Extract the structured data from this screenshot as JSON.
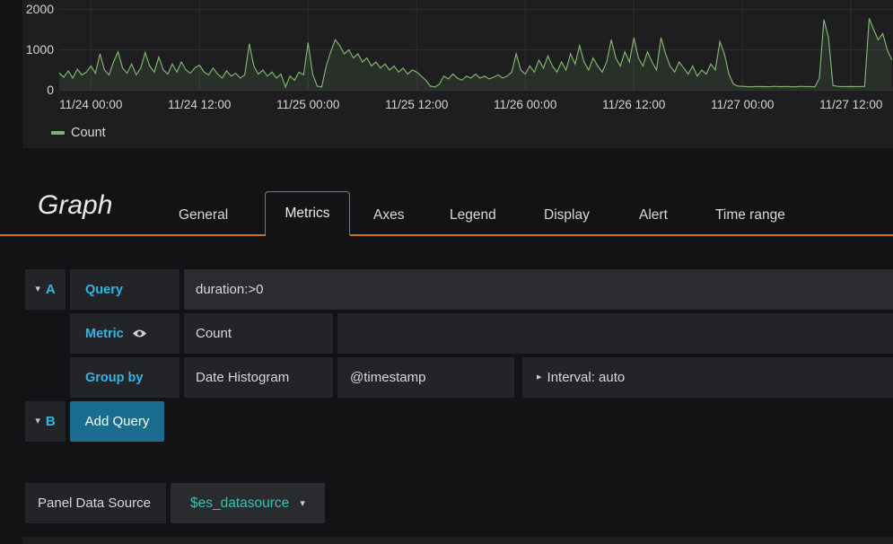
{
  "chart_data": {
    "type": "area",
    "title": "",
    "xlabel": "",
    "ylabel": "",
    "ylim": [
      0,
      2200
    ],
    "y_ticks": [
      0,
      1000,
      2000
    ],
    "grid": true,
    "legend_position": "bottom-left",
    "x_start": "11/23 20:30",
    "x_step_minutes": 30,
    "x_ticks": [
      {
        "label": "11/24 00:00",
        "index": 7
      },
      {
        "label": "11/24 12:00",
        "index": 31
      },
      {
        "label": "11/25 00:00",
        "index": 55
      },
      {
        "label": "11/25 12:00",
        "index": 79
      },
      {
        "label": "11/26 00:00",
        "index": 103
      },
      {
        "label": "11/26 12:00",
        "index": 127
      },
      {
        "label": "11/27 00:00",
        "index": 151
      },
      {
        "label": "11/27 12:00",
        "index": 175
      }
    ],
    "series": [
      {
        "name": "Count",
        "color": "#7eb26d",
        "fill_opacity": 0.12,
        "values": [
          430,
          320,
          480,
          300,
          520,
          380,
          450,
          600,
          420,
          900,
          500,
          380,
          700,
          950,
          550,
          420,
          650,
          380,
          550,
          930,
          600,
          450,
          820,
          500,
          400,
          650,
          450,
          700,
          500,
          420,
          560,
          620,
          450,
          380,
          550,
          400,
          300,
          480,
          350,
          420,
          300,
          380,
          1150,
          600,
          400,
          500,
          350,
          450,
          300,
          400,
          80,
          350,
          250,
          450,
          380,
          1180,
          400,
          100,
          80,
          600,
          950,
          1250,
          1100,
          900,
          1000,
          800,
          900,
          700,
          800,
          600,
          700,
          550,
          650,
          500,
          600,
          450,
          550,
          400,
          500,
          450,
          350,
          250,
          100,
          80,
          150,
          350,
          280,
          400,
          300,
          250,
          350,
          300,
          400,
          300,
          350,
          280,
          320,
          380,
          300,
          350,
          450,
          900,
          500,
          400,
          600,
          450,
          750,
          550,
          850,
          600,
          450,
          700,
          500,
          900,
          650,
          1100,
          700,
          500,
          800,
          600,
          450,
          700,
          1250,
          800,
          600,
          950,
          700,
          1300,
          800,
          600,
          950,
          700,
          500,
          1300,
          900,
          600,
          450,
          700,
          550,
          400,
          600,
          350,
          500,
          400,
          650,
          500,
          1200,
          900,
          400,
          150,
          100,
          95,
          90,
          85,
          92,
          88,
          90,
          85,
          95,
          90,
          88,
          92,
          85,
          90,
          95,
          88,
          90,
          85,
          300,
          1750,
          1300,
          120,
          95,
          90,
          88,
          92,
          88,
          90,
          95,
          1780,
          1500,
          1250,
          1400,
          1000,
          750
        ]
      }
    ]
  },
  "editor": {
    "title": "Graph",
    "tabs": [
      {
        "label": "General",
        "active": false
      },
      {
        "label": "Metrics",
        "active": true
      },
      {
        "label": "Axes",
        "active": false
      },
      {
        "label": "Legend",
        "active": false
      },
      {
        "label": "Display",
        "active": false
      },
      {
        "label": "Alert",
        "active": false
      },
      {
        "label": "Time range",
        "active": false
      }
    ],
    "rows": {
      "a": {
        "collapse_icon": "▾",
        "letter": "A",
        "query_label": "Query",
        "query_value": "duration:>0",
        "metric_label": "Metric",
        "metric_value": "Count",
        "groupby_label": "Group by",
        "groupby_type": "Date Histogram",
        "groupby_field": "@timestamp",
        "interval_caret": "▸",
        "interval_value": "Interval: auto"
      },
      "b": {
        "collapse_icon": "▾",
        "letter": "B",
        "add_query_label": "Add Query"
      }
    },
    "datasource": {
      "label": "Panel Data Source",
      "value": "$es_datasource",
      "caret": "▾"
    }
  },
  "colors": {
    "accent_blue": "#33b5e5",
    "series_green": "#7eb26d",
    "tab_orange": "#cf7216",
    "button_teal": "#1a6d8e",
    "variable_teal": "#3dc0b4"
  }
}
